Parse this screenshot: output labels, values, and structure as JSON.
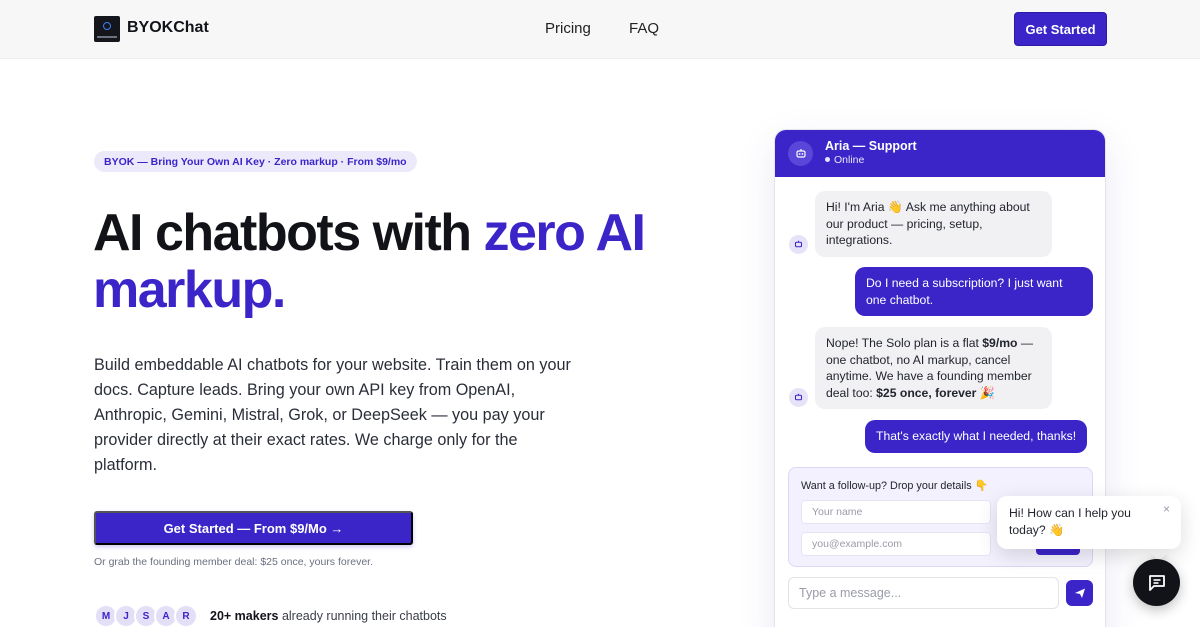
{
  "nav": {
    "brand": "BYOKChat",
    "links": [
      "Pricing",
      "FAQ"
    ],
    "cta": "Get Started"
  },
  "hero": {
    "badge": "BYOK — Bring Your Own AI Key · Zero markup · From $9/mo",
    "headline_part1": "AI chatbots with ",
    "headline_accent1": "zero AI",
    "headline_accent2": "markup.",
    "lead": "Build embeddable AI chatbots for your website. Train them on your docs. Capture leads. Bring your own API key from OpenAI, Anthropic, Gemini, Mistral, Grok, or DeepSeek — you pay your provider directly at their exact rates. We charge only for the platform.",
    "cta": "Get Started — From $9/Mo →",
    "founding_note": "Or grab the founding member deal: $25 once, yours forever.",
    "avatars": [
      "M",
      "J",
      "S",
      "A",
      "R"
    ],
    "makers_bold": "20+ makers",
    "makers_rest": " already running their chatbots"
  },
  "chat": {
    "name": "Aria — Support",
    "status": "Online",
    "messages": {
      "bot1": "Hi! I'm Aria 👋 Ask me anything about our product — pricing, setup, integrations.",
      "user1": "Do I need a subscription? I just want one chatbot.",
      "bot2_a": "Nope! The Solo plan is a flat ",
      "bot2_b": "$9/mo",
      "bot2_c": " — one chatbot, no AI markup, cancel anytime. We have a founding member deal too: ",
      "bot2_d": "$25 once, forever",
      "bot2_e": " 🎉",
      "user2": "That's exactly what I needed, thanks!"
    },
    "form": {
      "title": "Want a follow-up? Drop your details 👇",
      "name_placeholder": "Your name",
      "email_placeholder": "you@example.com"
    },
    "input_placeholder": "Type a message..."
  },
  "popup": {
    "text": "Hi! How can I help you today? 👋",
    "close": "×"
  },
  "colors": {
    "accent": "#3b25c9",
    "badge_bg": "#ece9fb",
    "bubble_bot": "#f1f1f4",
    "launcher": "#111318"
  }
}
